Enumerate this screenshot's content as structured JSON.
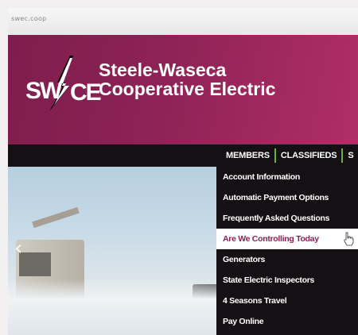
{
  "browser": {
    "url": "swec.coop"
  },
  "header": {
    "logo_text": "SWCE",
    "brand_line1": "Steele-Waseca",
    "brand_line2": "Cooperative Electric",
    "color": "#8e2256"
  },
  "nav": {
    "tabs": [
      {
        "label": "MEMBERS"
      },
      {
        "label": "CLASSIFIEDS"
      },
      {
        "label": "S"
      }
    ],
    "separator_color": "#6fae3a"
  },
  "menu": {
    "items": [
      {
        "label": "Account Information",
        "active": false
      },
      {
        "label": "Automatic Payment Options",
        "active": false
      },
      {
        "label": "Frequently Asked Questions",
        "active": false
      },
      {
        "label": "Are We Controlling Today",
        "active": true
      },
      {
        "label": "Generators",
        "active": false
      },
      {
        "label": "State Electric Inspectors",
        "active": false
      },
      {
        "label": "4 Seasons Travel",
        "active": false
      },
      {
        "label": "Pay Online",
        "active": false
      }
    ],
    "active_text_color": "#8b1f52"
  },
  "hero": {
    "prev_icon": "chevron-left-icon"
  }
}
